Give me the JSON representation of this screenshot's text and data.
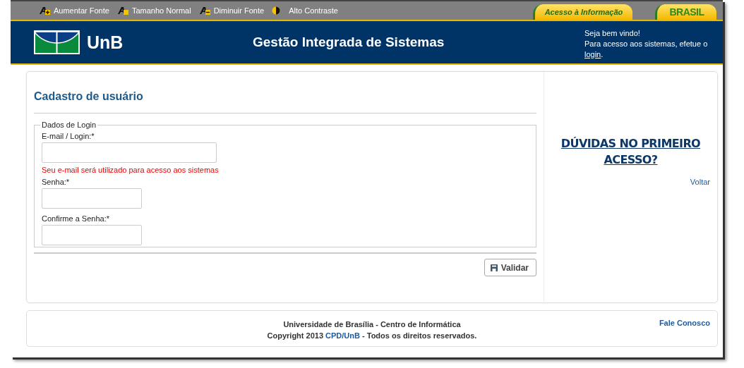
{
  "accessibility_bar": {
    "links": [
      {
        "label": "Aumentar Fonte",
        "kind": "increase"
      },
      {
        "label": "Tamanho Normal",
        "kind": "normal"
      },
      {
        "label": "Diminuir Fonte",
        "kind": "decrease"
      },
      {
        "label": "Alto Contraste",
        "kind": "contrast"
      }
    ],
    "tabs": [
      {
        "label": "Acesso à Informação",
        "kind": "info"
      },
      {
        "label": "BRASIL",
        "kind": "brasil"
      }
    ]
  },
  "header": {
    "logo_text": "UnB",
    "title": "Gestão Integrada de Sistemas",
    "welcome": "Seja bem vindo!",
    "login_prompt": "Para acesso aos sistemas, efetue o",
    "login_link": "login",
    "login_suffix": "."
  },
  "form": {
    "title": "Cadastro de usuário",
    "fieldset_legend": "Dados de Login",
    "fields": [
      {
        "label": "E-mail / Login:*",
        "kind": "wide",
        "hint": "Seu e-mail será utilizado para acesso aos sistemas"
      },
      {
        "label": "Senha:*",
        "kind": "narrow"
      },
      {
        "label": "Confirme a Senha:*",
        "kind": "narrow"
      }
    ],
    "submit_button": "Validar"
  },
  "side_panel": {
    "help_link": "DÚVIDAS NO PRIMEIRO ACESSO?",
    "back_link": "Voltar"
  },
  "footer": {
    "line_1": "Universidade de Brasília - Centro de Informática",
    "copyright_prefix": "Copyright 2013",
    "copyright_link": "CPD/UnB",
    "copyright_suffix": "- Todos os direitos reservados.",
    "contact_link": "Fale Conosco"
  }
}
